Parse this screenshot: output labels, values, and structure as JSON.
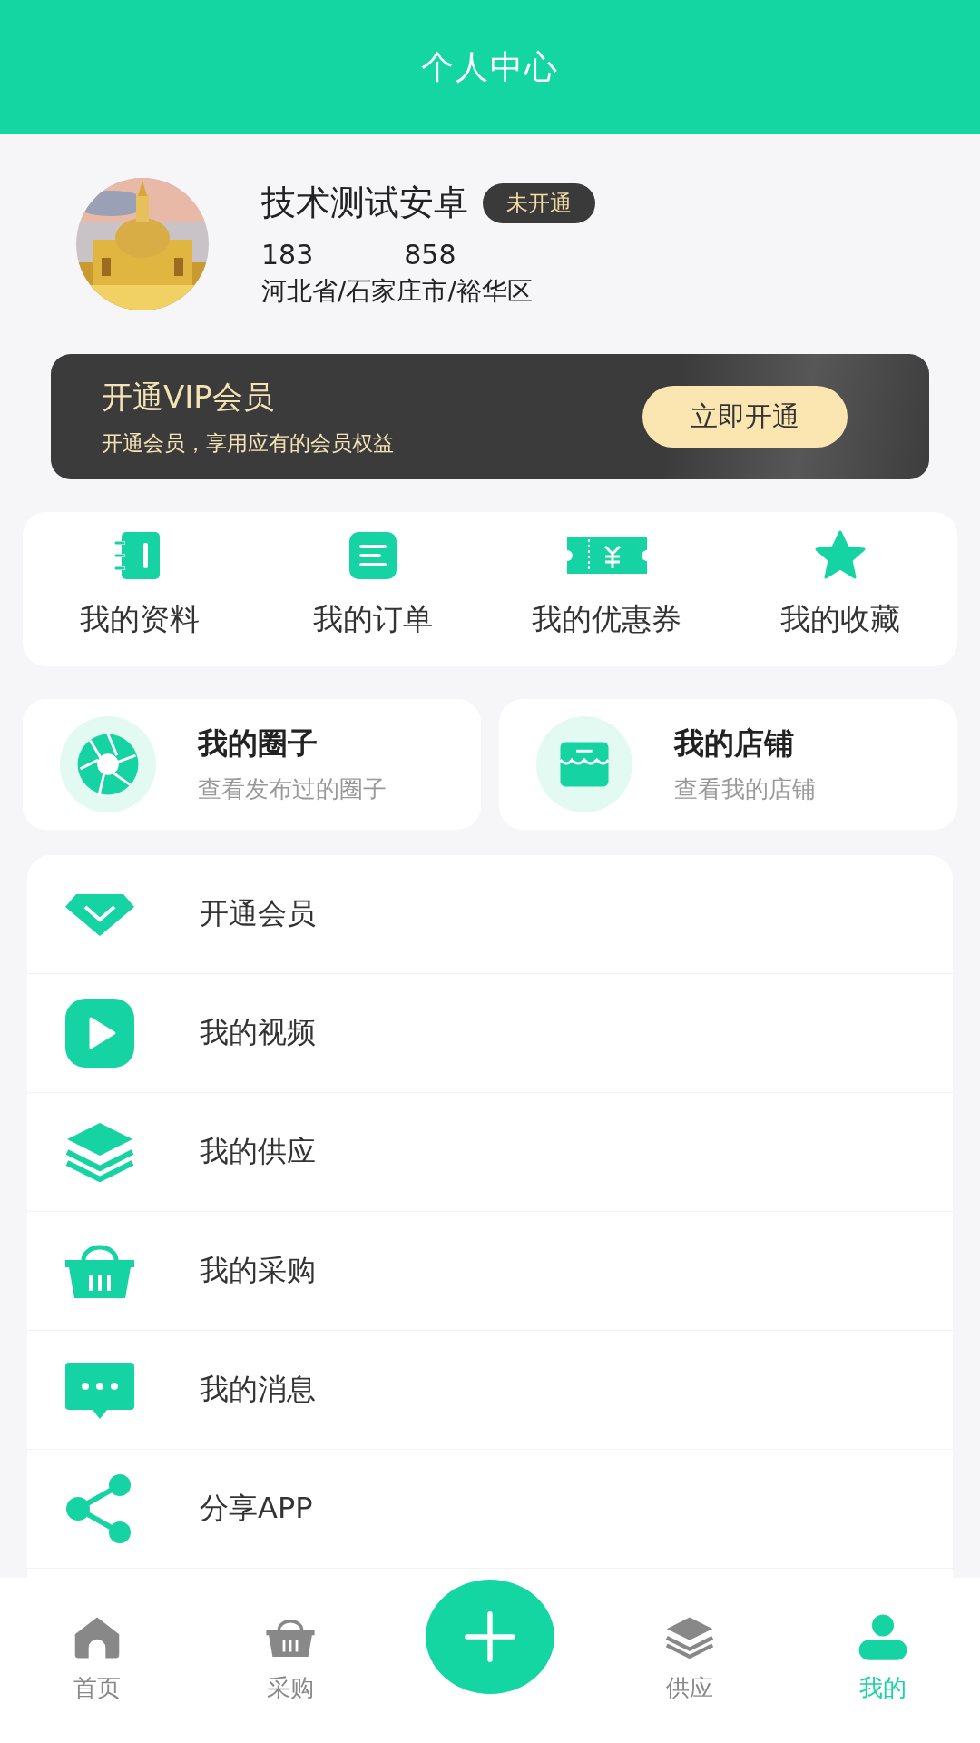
{
  "header": {
    "title": "个人中心"
  },
  "profile": {
    "name": "技术测试安卓",
    "badge": "未开通",
    "stats": [
      "183",
      "858"
    ],
    "location": "河北省/石家庄市/裕华区"
  },
  "vip": {
    "title": "开通VIP会员",
    "subtitle": "开通会员，享用应有的会员权益",
    "button": "立即开通"
  },
  "shortcuts": [
    {
      "kind": "notebook",
      "label": "我的资料"
    },
    {
      "kind": "list",
      "label": "我的订单"
    },
    {
      "kind": "coupon",
      "label": "我的优惠券"
    },
    {
      "kind": "star",
      "label": "我的收藏"
    }
  ],
  "cards": [
    {
      "kind": "aperture",
      "title": "我的圈子",
      "subtitle": "查看发布过的圈子"
    },
    {
      "kind": "shop",
      "title": "我的店铺",
      "subtitle": "查看我的店铺"
    }
  ],
  "menu": [
    {
      "kind": "diamond",
      "label": "开通会员"
    },
    {
      "kind": "play",
      "label": "我的视频"
    },
    {
      "kind": "layers",
      "label": "我的供应"
    },
    {
      "kind": "basket",
      "label": "我的采购"
    },
    {
      "kind": "chat",
      "label": "我的消息"
    },
    {
      "kind": "share",
      "label": "分享APP"
    }
  ],
  "nav": [
    {
      "kind": "home",
      "label": "首页",
      "selected": false
    },
    {
      "kind": "basket",
      "label": "采购",
      "selected": false
    },
    {
      "kind": "add"
    },
    {
      "kind": "layers",
      "label": "供应",
      "selected": false
    },
    {
      "kind": "user",
      "label": "我的",
      "selected": true
    }
  ]
}
